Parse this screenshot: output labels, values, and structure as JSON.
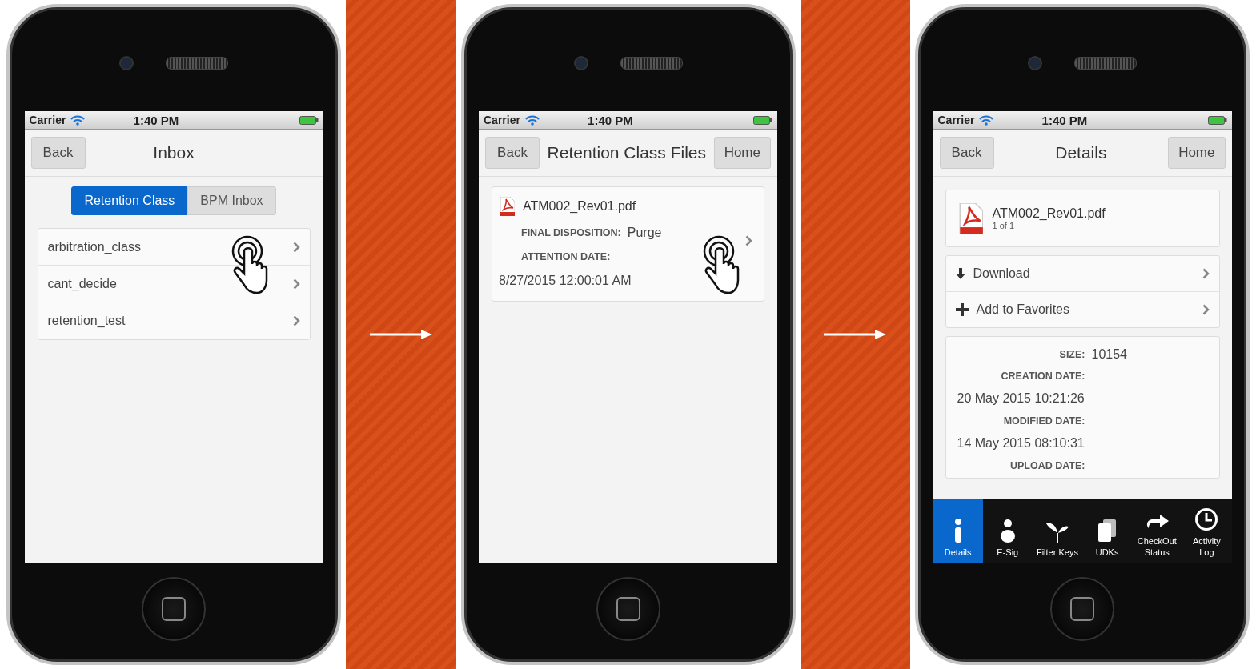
{
  "screens": [
    {
      "kind": "inbox",
      "status_bar": {
        "carrier": "Carrier",
        "time": "1:40 PM"
      },
      "nav": {
        "back": "Back",
        "title": "Inbox"
      },
      "segments": [
        {
          "label": "Retention Class",
          "selected": true
        },
        {
          "label": "BPM Inbox",
          "selected": false
        }
      ],
      "list": [
        {
          "label": "arbitration_class",
          "tap_hint": true
        },
        {
          "label": "cant_decide",
          "tap_hint": false
        },
        {
          "label": "retention_test",
          "tap_hint": false
        }
      ]
    },
    {
      "kind": "files",
      "status_bar": {
        "carrier": "Carrier",
        "time": "1:40 PM"
      },
      "nav": {
        "back": "Back",
        "title": "Retention Class Files",
        "home": "Home"
      },
      "file": {
        "name": "ATM002_Rev01.pdf",
        "tap_hint": true,
        "fields": [
          {
            "kind": "inline",
            "label": "FINAL DISPOSITION:",
            "value": "Purge"
          },
          {
            "kind": "stacked",
            "label": "ATTENTION DATE:",
            "value": "8/27/2015 12:00:01 AM"
          }
        ]
      }
    },
    {
      "kind": "details",
      "status_bar": {
        "carrier": "Carrier",
        "time": "1:40 PM"
      },
      "nav": {
        "back": "Back",
        "title": "Details",
        "home": "Home"
      },
      "file": {
        "name": "ATM002_Rev01.pdf",
        "pages": "1 of 1"
      },
      "actions": [
        {
          "kind": "download",
          "label": "Download"
        },
        {
          "kind": "add",
          "label": "Add to Favorites"
        }
      ],
      "fields": [
        {
          "kind": "inline",
          "label": "SIZE:",
          "value": "10154"
        },
        {
          "kind": "stacked",
          "label": "CREATION DATE:",
          "value": "20 May 2015 10:21:26"
        },
        {
          "kind": "stacked",
          "label": "MODIFIED DATE:",
          "value": "14 May 2015 08:10:31"
        },
        {
          "kind": "stacked",
          "label": "UPLOAD DATE:"
        }
      ],
      "tabs": [
        {
          "kind": "info",
          "label": "Details",
          "selected": true
        },
        {
          "kind": "person",
          "label": "E-Sig",
          "selected": false
        },
        {
          "kind": "filter",
          "label": "Filter Keys",
          "selected": false
        },
        {
          "kind": "docs",
          "label": "UDKs",
          "selected": false
        },
        {
          "kind": "share",
          "label": "CheckOut Status",
          "selected": false
        },
        {
          "kind": "clock",
          "label": "Activity Log",
          "selected": false
        }
      ]
    }
  ]
}
